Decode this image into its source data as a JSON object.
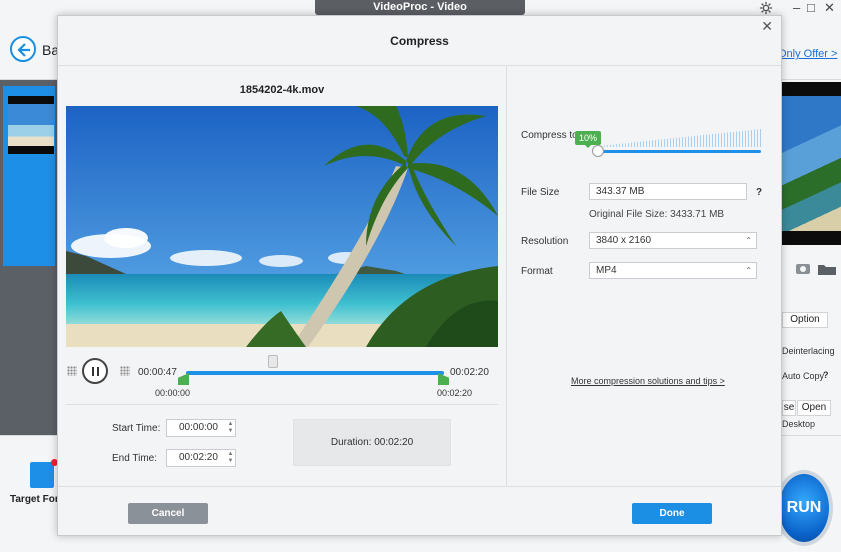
{
  "app": {
    "title": "VideoProc - Video",
    "back_label": "Ba",
    "offer_link": "Only Offer >",
    "target_format_label": "Target For",
    "run_label": "RUN",
    "window_controls": {
      "minimize": "–",
      "maximize": "□",
      "close": "✕"
    },
    "right_panel": {
      "option_label": "Option",
      "deinterlacing_label": "Deinterlacing",
      "auto_copy_label": "Auto Copy",
      "auto_copy_help": "?",
      "browse_label": "se",
      "open_label": "Open",
      "output_folder": "Desktop"
    }
  },
  "dialog": {
    "title": "Compress",
    "close_glyph": "✕",
    "file_name": "1854202-4k.mov",
    "playback": {
      "current_time": "00:00:47",
      "end_time": "00:02:20",
      "trim_start_label": "00:00:00",
      "trim_end_label": "00:02:20"
    },
    "start_time": {
      "label": "Start Time:",
      "value": "00:00:00"
    },
    "end_time_field": {
      "label": "End Time:",
      "value": "00:02:20"
    },
    "duration": {
      "label": "Duration:",
      "value": "00:02:20"
    },
    "compress": {
      "label": "Compress to",
      "percent": "10%"
    },
    "file_size": {
      "label": "File Size",
      "value": "343.37  MB",
      "help": "?"
    },
    "original_size": "Original File Size: 3433.71 MB",
    "resolution": {
      "label": "Resolution",
      "value": "3840 x 2160"
    },
    "format": {
      "label": "Format",
      "value": "MP4"
    },
    "tips_link": "More compression solutions and tips >",
    "cancel_label": "Cancel",
    "done_label": "Done"
  }
}
